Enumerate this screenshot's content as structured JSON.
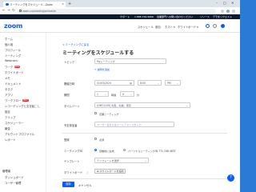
{
  "browser": {
    "tab_title": "ミーティングをスケジュール - Zoom",
    "url": "zoom.us/meeting/schedule",
    "new_tab": "+",
    "minimize": "–",
    "maximize": "□",
    "close": "✕",
    "tab_close": "×",
    "back": "←",
    "forward": "→",
    "reload": "↻"
  },
  "promo_bar": {
    "support": "サポート",
    "phone": "1.888.799.9666",
    "request_demo": "営業部門へお問い合わせください",
    "resources": "リソース",
    "open_app": "デモをリクエスト"
  },
  "header": {
    "logo": "zoom",
    "nav": [
      "スケジュール",
      "参加",
      "ホスト ▾",
      "ホワイトボード ▾"
    ]
  },
  "sidebar": {
    "items": [
      {
        "label": "ホーム",
        "badge": ""
      },
      {
        "label": "個人用",
        "badge": ""
      },
      {
        "label": "プロフィール",
        "badge": ""
      },
      {
        "label": "ミーティング",
        "badge": ""
      },
      {
        "label": "Webinars",
        "badge": ""
      },
      {
        "label": "ワーク",
        "badge": "NEW"
      },
      {
        "label": "ホワイトボード",
        "badge": ""
      },
      {
        "label": "メモ",
        "badge": ""
      },
      {
        "label": "ドキュメント",
        "badge": ""
      },
      {
        "label": "タスク",
        "badge": ""
      },
      {
        "label": "アプリ",
        "badge": ""
      },
      {
        "label": "ワークフロー",
        "badge": "NEW"
      },
      {
        "label": "レコーディングと文字起こし",
        "badge": ""
      },
      {
        "label": "設定",
        "badge": ""
      },
      {
        "label": "クリップ",
        "badge": ""
      },
      {
        "label": "スケジューラー",
        "badge": ""
      },
      {
        "label": "報告",
        "badge": ""
      },
      {
        "label": "アカウントプロファイル",
        "badge": ""
      },
      {
        "label": "レポート",
        "badge": ""
      }
    ],
    "section_admin": "管理者",
    "admin_items": [
      "ダッシュボード",
      "ユーザー管理"
    ]
  },
  "form": {
    "back_link": "< ミーティングに戻る",
    "title": "ミーティングをスケジュールする",
    "topic_label": "トピック",
    "topic_value": "Myミーティング",
    "add_description": "+ 説明を追加",
    "when_label": "開催日時",
    "date_value": "01/03/2024",
    "time_value": "8:00",
    "ampm_value": "PM",
    "duration_label": "期間",
    "duration_hours": "1",
    "hours_unit": "時間",
    "duration_minutes": "0",
    "minutes_unit": "分",
    "timezone_label": "タイムゾーン",
    "timezone_value": "(GMT-5:00) 大阪、札幌、東京",
    "recurring_label": "定期ミーティング",
    "attendees_label": "予定参加者",
    "attendees_placeholder": "ユーザー名またはメールアドレスを入力",
    "registration_label": "登録",
    "required_label": "必須",
    "meeting_id_label": "ミーティングID",
    "auto_generate": "自動的に生成",
    "pmi": "パーソナルミーティングID 771 246 4837",
    "template_label": "テンプレート",
    "template_value": "テンプレートを選択",
    "whiteboard_label": "ホワイトボード",
    "add_whiteboard": "ホワイトボードを追加",
    "save": "保存",
    "cancel": "キャンセル"
  },
  "help_icon": "?",
  "colors": {
    "accent": "#0b5cff",
    "badge": "#e02828",
    "promo_bg": "#0e1b2e"
  }
}
